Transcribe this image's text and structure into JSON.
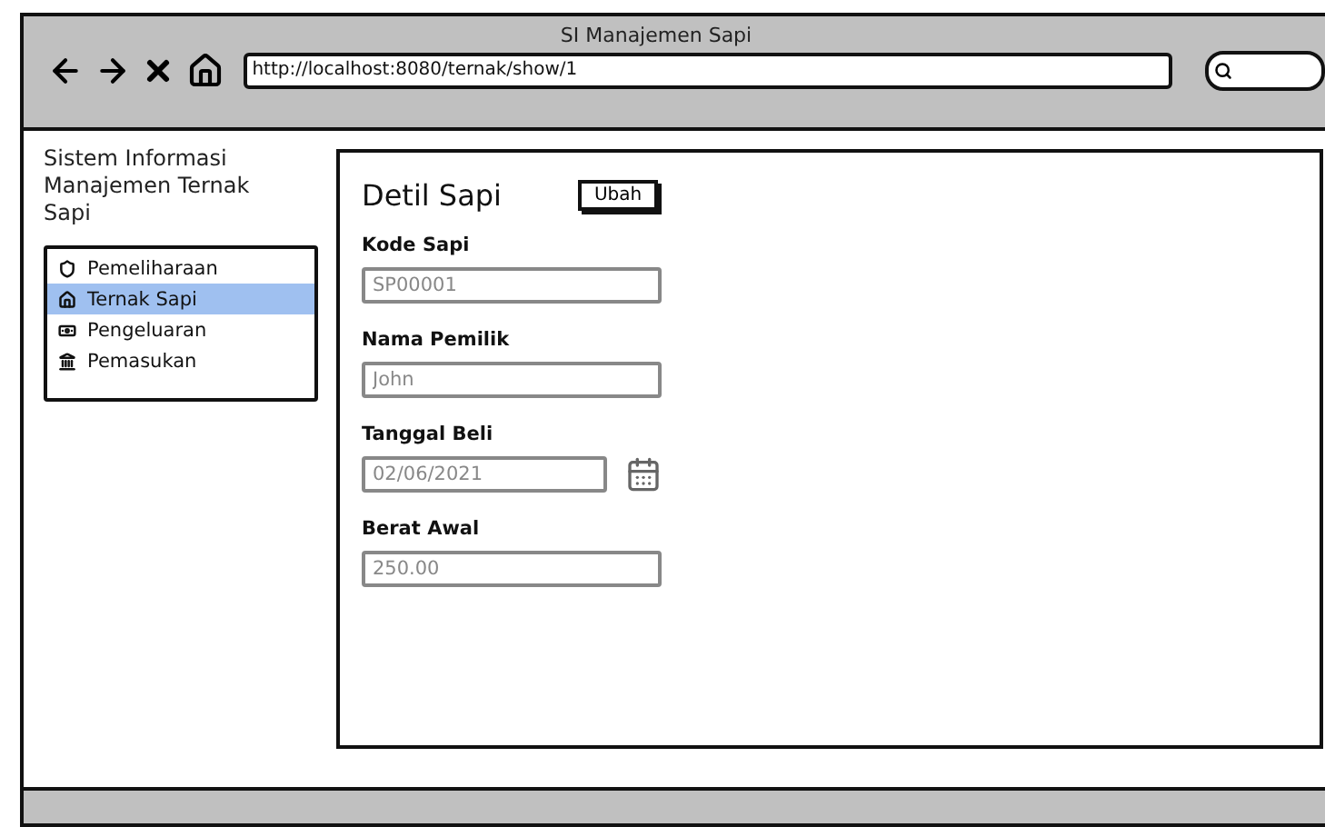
{
  "window": {
    "title": "SI Manajemen Sapi",
    "url": "http://localhost:8080/ternak/show/1"
  },
  "sidebar": {
    "title": "Sistem Informasi Manajemen Ternak Sapi",
    "items": [
      {
        "label": "Pemeliharaan",
        "kind": "shield",
        "selected": false
      },
      {
        "label": "Ternak Sapi",
        "kind": "home",
        "selected": true
      },
      {
        "label": "Pengeluaran",
        "kind": "money",
        "selected": false
      },
      {
        "label": "Pemasukan",
        "kind": "bank",
        "selected": false
      }
    ]
  },
  "detail": {
    "title": "Detil Sapi",
    "edit_button": "Ubah",
    "fields": [
      {
        "label": "Kode Sapi",
        "value": "SP00001",
        "kind": "text"
      },
      {
        "label": "Nama Pemilik",
        "value": "John",
        "kind": "text"
      },
      {
        "label": "Tanggal Beli",
        "value": "02/06/2021",
        "kind": "date"
      },
      {
        "label": "Berat Awal",
        "value": "250.00",
        "kind": "text"
      }
    ]
  }
}
